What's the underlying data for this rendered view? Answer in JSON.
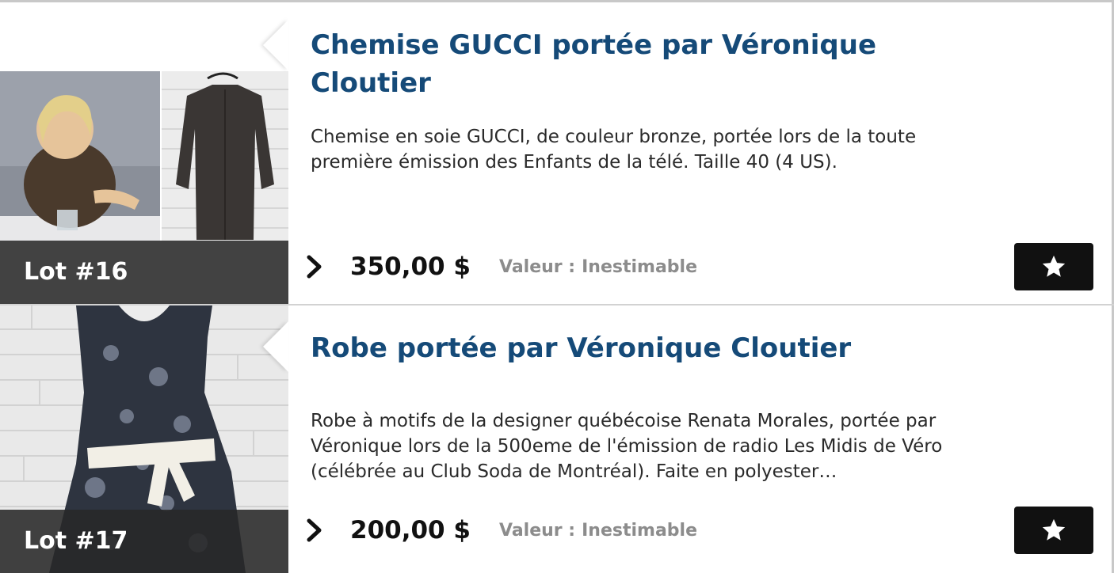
{
  "lots": [
    {
      "lot_label": "Lot #16",
      "title": "Chemise GUCCI portée par Véronique Cloutier",
      "description": "Chemise en soie GUCCI, de couleur bronze, portée lors de la toute première émission des Enfants de la télé. Taille 40 (4 US).",
      "price": "350,00 $",
      "valeur_label": "Valeur :",
      "valeur_value": "Inestimable"
    },
    {
      "lot_label": "Lot #17",
      "title": "Robe portée par Véronique Cloutier",
      "description": "Robe à motifs de la designer québécoise Renata Morales, portée par Véronique lors de la 500eme de l'émission de radio Les Midis de Véro (célébrée au Club Soda de Montréal). Faite en polyester…",
      "price": "200,00 $",
      "valeur_label": "Valeur :",
      "valeur_value": "Inestimable"
    }
  ],
  "icons": {
    "details": "chevron-right-icon",
    "favorite": "star-icon"
  },
  "colors": {
    "title": "#154a78",
    "button_bg": "#111111",
    "badge_bg": "#282828",
    "muted": "#8c8c8c"
  }
}
